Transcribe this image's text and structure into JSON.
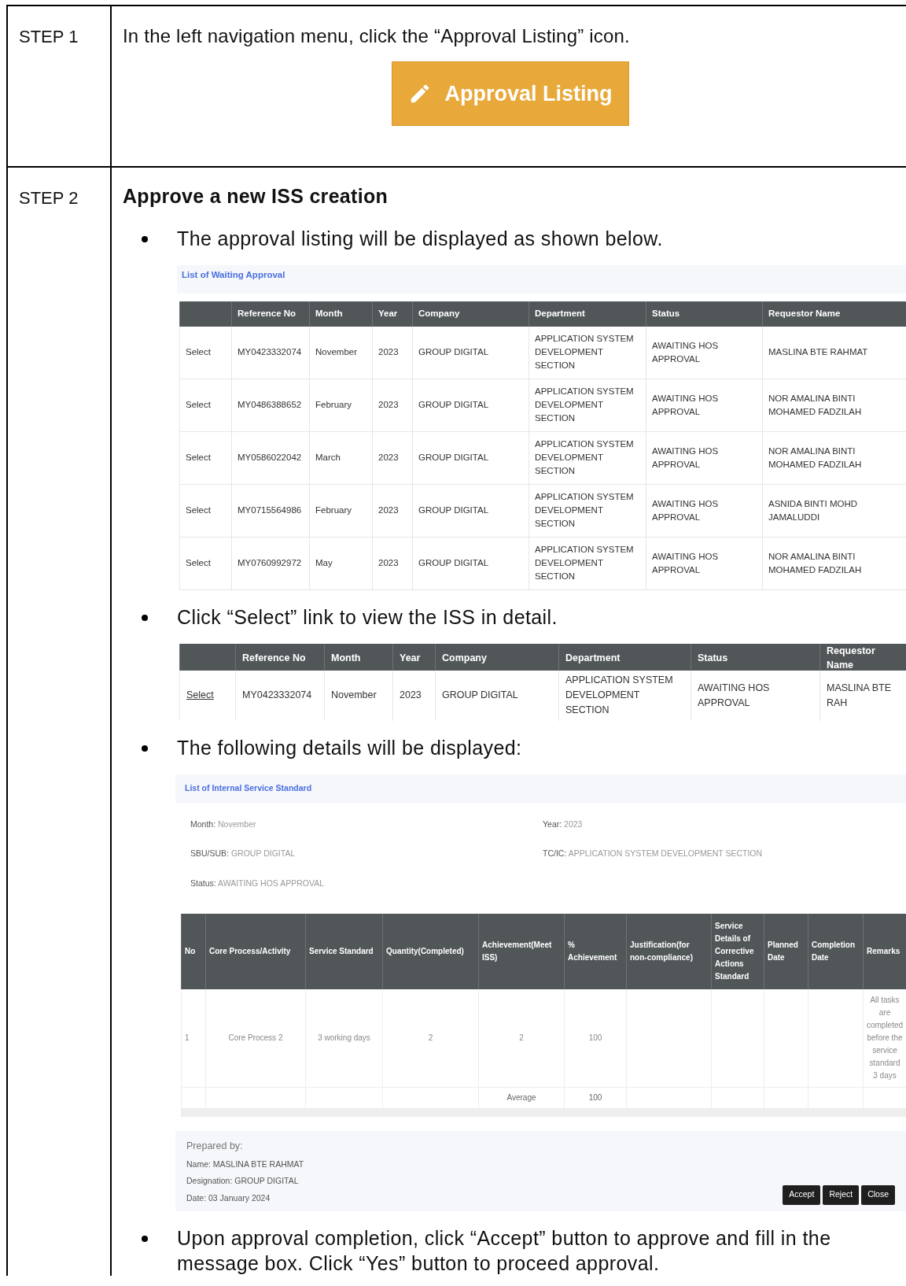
{
  "steps": [
    {
      "label": "STEP 1",
      "instruction": "In the left navigation menu, click the “Approval Listing” icon.",
      "nav_button": {
        "label": "Approval Listing"
      }
    },
    {
      "label": "STEP 2",
      "heading": "Approve a new ISS creation",
      "sections": [
        {
          "kind": "bullet",
          "text": "The approval listing will be displayed as shown below."
        },
        {
          "kind": "listing",
          "title": "List of Waiting Approval",
          "columns": [
            "",
            "Reference No",
            "Month",
            "Year",
            "Company",
            "Department",
            "Status",
            "Requestor Name"
          ],
          "rows": [
            [
              "Select",
              "MY0423332074",
              "November",
              "2023",
              "GROUP DIGITAL",
              "APPLICATION SYSTEM DEVELOPMENT SECTION",
              "AWAITING HOS APPROVAL",
              "MASLINA BTE RAHMAT"
            ],
            [
              "Select",
              "MY0486388652",
              "February",
              "2023",
              "GROUP DIGITAL",
              "APPLICATION SYSTEM DEVELOPMENT SECTION",
              "AWAITING HOS APPROVAL",
              "NOR AMALINA BINTI MOHAMED FADZILAH"
            ],
            [
              "Select",
              "MY0586022042",
              "March",
              "2023",
              "GROUP DIGITAL",
              "APPLICATION SYSTEM DEVELOPMENT SECTION",
              "AWAITING HOS APPROVAL",
              "NOR AMALINA BINTI MOHAMED FADZILAH"
            ],
            [
              "Select",
              "MY0715564986",
              "February",
              "2023",
              "GROUP DIGITAL",
              "APPLICATION SYSTEM DEVELOPMENT SECTION",
              "AWAITING HOS APPROVAL",
              "ASNIDA BINTI MOHD JAMALUDDI"
            ],
            [
              "Select",
              "MY0760992972",
              "May",
              "2023",
              "GROUP DIGITAL",
              "APPLICATION SYSTEM DEVELOPMENT SECTION",
              "AWAITING HOS APPROVAL",
              "NOR AMALINA BINTI MOHAMED FADZILAH"
            ]
          ]
        },
        {
          "kind": "bullet",
          "text": "Click “Select” link to view the ISS in detail."
        },
        {
          "kind": "selected_row",
          "columns": [
            "",
            "Reference No",
            "Month",
            "Year",
            "Company",
            "Department",
            "Status",
            "Requestor Name"
          ],
          "rows": [
            [
              "Select",
              "MY0423332074",
              "November",
              "2023",
              "GROUP DIGITAL",
              "APPLICATION SYSTEM DEVELOPMENT SECTION",
              "AWAITING HOS APPROVAL",
              "MASLINA BTE RAH"
            ]
          ]
        },
        {
          "kind": "bullet",
          "text": "The following details will be displayed:"
        },
        {
          "kind": "detail",
          "title": "List of Internal Service Standard",
          "fields": [
            {
              "label": "Month:",
              "value": "November"
            },
            {
              "label": "Year:",
              "value": "2023"
            },
            {
              "label": "SBU/SUB:",
              "value": "GROUP DIGITAL"
            },
            {
              "label": "TC/IC:",
              "value": "APPLICATION SYSTEM DEVELOPMENT SECTION"
            },
            {
              "label": "Status:",
              "value": "AWAITING HOS APPROVAL"
            }
          ],
          "columns": [
            "No",
            "Core Process/Activity",
            "Service Standard",
            "Quantity(Completed)",
            "Achievement(Meet ISS)",
            "% Achievement",
            "Justification(for non-compliance)",
            "Service Details of Corrective Actions Standard",
            "Planned Date",
            "Completion Date",
            "Remarks"
          ],
          "rows": [
            [
              "1",
              "Core Process 2",
              "3 working days",
              "2",
              "2",
              "100",
              "",
              "",
              "",
              "",
              "All tasks are completed before the service standard 3 days"
            ],
            [
              "",
              "",
              "",
              "",
              "Average",
              "100",
              "",
              "",
              "",
              "",
              ""
            ]
          ],
          "prepared_by": {
            "heading": "Prepared by:",
            "lines": [
              "Name: MASLINA BTE RAHMAT",
              "Designation: GROUP DIGITAL",
              "Date: 03 January 2024"
            ]
          },
          "buttons": [
            "Accept",
            "Reject",
            "Close"
          ]
        },
        {
          "kind": "bullet",
          "text": "Upon approval completion, click “Accept” button to approve and fill in the message box. Click “Yes” button to proceed approval."
        }
      ]
    }
  ]
}
